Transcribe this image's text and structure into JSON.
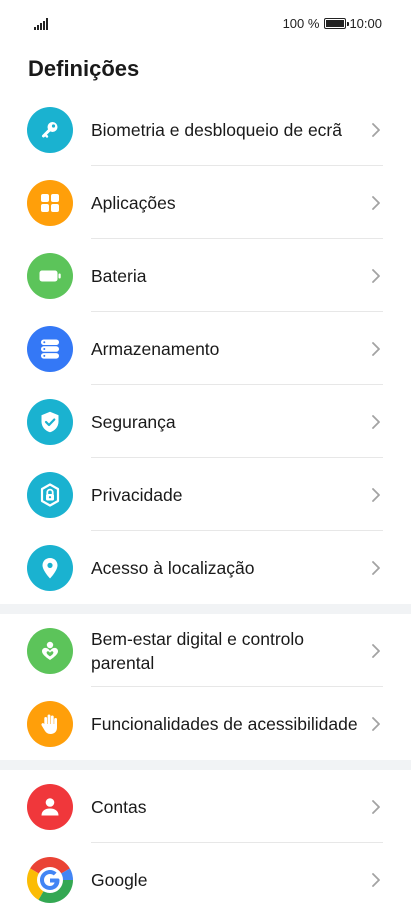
{
  "status_bar": {
    "battery_percent": "100 %",
    "time": "10:00"
  },
  "page_title": "Definições",
  "groups": [
    {
      "items": [
        {
          "label": "Biometria e desbloqueio de ecrã",
          "icon": "key-icon",
          "color": "#1ab2d0"
        },
        {
          "label": "Aplicações",
          "icon": "apps-grid-icon",
          "color": "#ff9f0a"
        },
        {
          "label": "Bateria",
          "icon": "battery-icon",
          "color": "#5cc45a"
        },
        {
          "label": "Armazenamento",
          "icon": "storage-icon",
          "color": "#3478f6"
        },
        {
          "label": "Segurança",
          "icon": "shield-check-icon",
          "color": "#1ab2d0"
        },
        {
          "label": "Privacidade",
          "icon": "privacy-lock-icon",
          "color": "#1ab2d0"
        },
        {
          "label": "Acesso à localização",
          "icon": "location-pin-icon",
          "color": "#1ab2d0"
        }
      ]
    },
    {
      "items": [
        {
          "label": "Bem-estar digital e controlo parental",
          "icon": "digital-wellbeing-icon",
          "color": "#5cc45a"
        },
        {
          "label": "Funcionalidades de acessibilidade",
          "icon": "hand-icon",
          "color": "#ff9f0a"
        }
      ]
    },
    {
      "items": [
        {
          "label": "Contas",
          "icon": "account-person-icon",
          "color": "#f0373b"
        },
        {
          "label": "Google",
          "icon": "google-g-icon",
          "color": "#ffffff"
        }
      ]
    }
  ]
}
